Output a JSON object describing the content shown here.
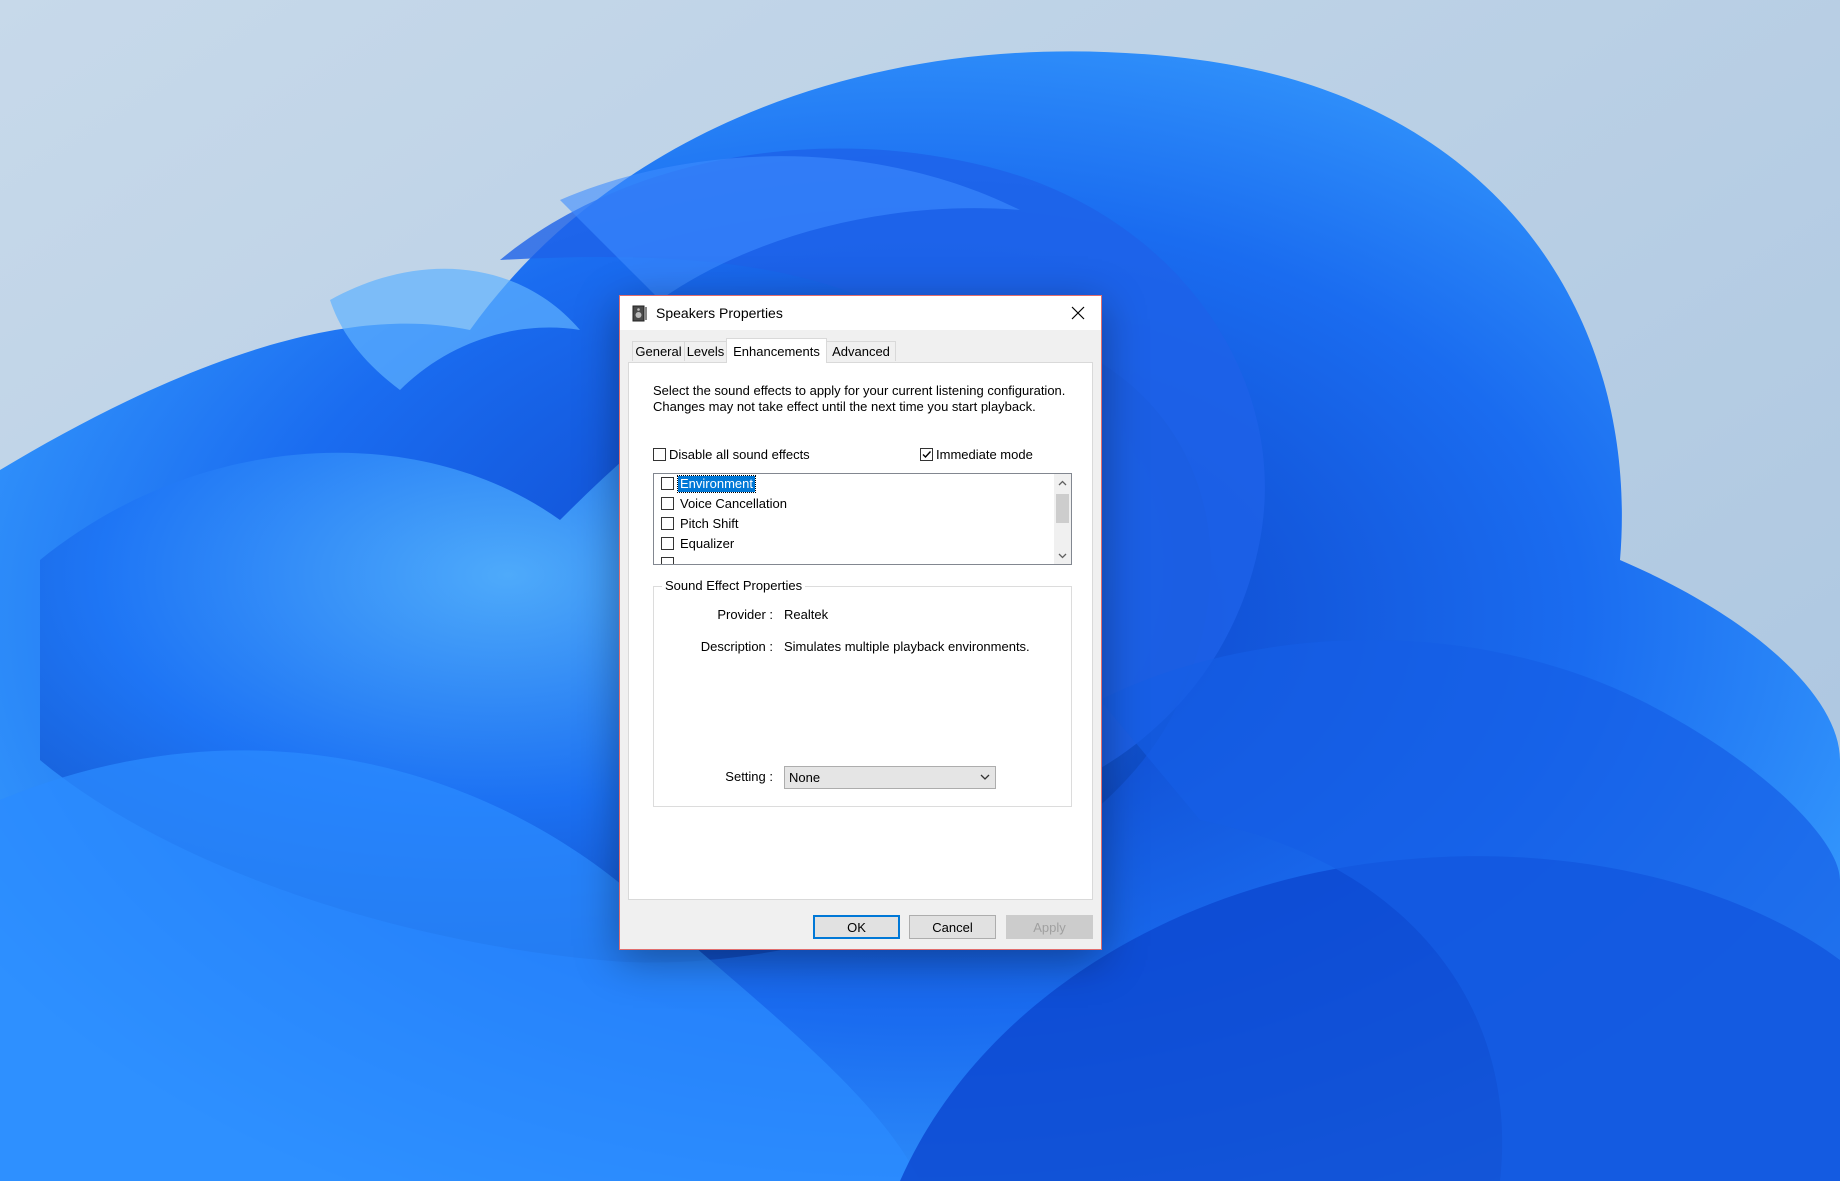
{
  "dialog": {
    "title": "Speakers Properties",
    "tabs": [
      {
        "label": "General"
      },
      {
        "label": "Levels"
      },
      {
        "label": "Enhancements"
      },
      {
        "label": "Advanced"
      }
    ],
    "active_tab": "Enhancements",
    "intro_text": "Select the sound effects to apply for your current listening configuration. Changes may not take effect until the next time you start playback.",
    "disable_all": {
      "label": "Disable all sound effects",
      "checked": false
    },
    "immediate_mode": {
      "label": "Immediate mode",
      "checked": true
    },
    "effects": [
      {
        "label": "Environment",
        "checked": false,
        "selected": true
      },
      {
        "label": "Voice Cancellation",
        "checked": false,
        "selected": false
      },
      {
        "label": "Pitch Shift",
        "checked": false,
        "selected": false
      },
      {
        "label": "Equalizer",
        "checked": false,
        "selected": false
      }
    ],
    "sound_effect_properties": {
      "title": "Sound Effect Properties",
      "provider_label": "Provider :",
      "provider_value": "Realtek",
      "description_label": "Description :",
      "description_value": "Simulates multiple playback environments.",
      "setting_label": "Setting :",
      "setting_value": "None"
    },
    "buttons": {
      "ok": "OK",
      "cancel": "Cancel",
      "apply": "Apply"
    }
  },
  "colors": {
    "accent": "#0078d7",
    "dialog_border": "#e06d6d",
    "wallpaper_blue": "#0a5ce6"
  }
}
